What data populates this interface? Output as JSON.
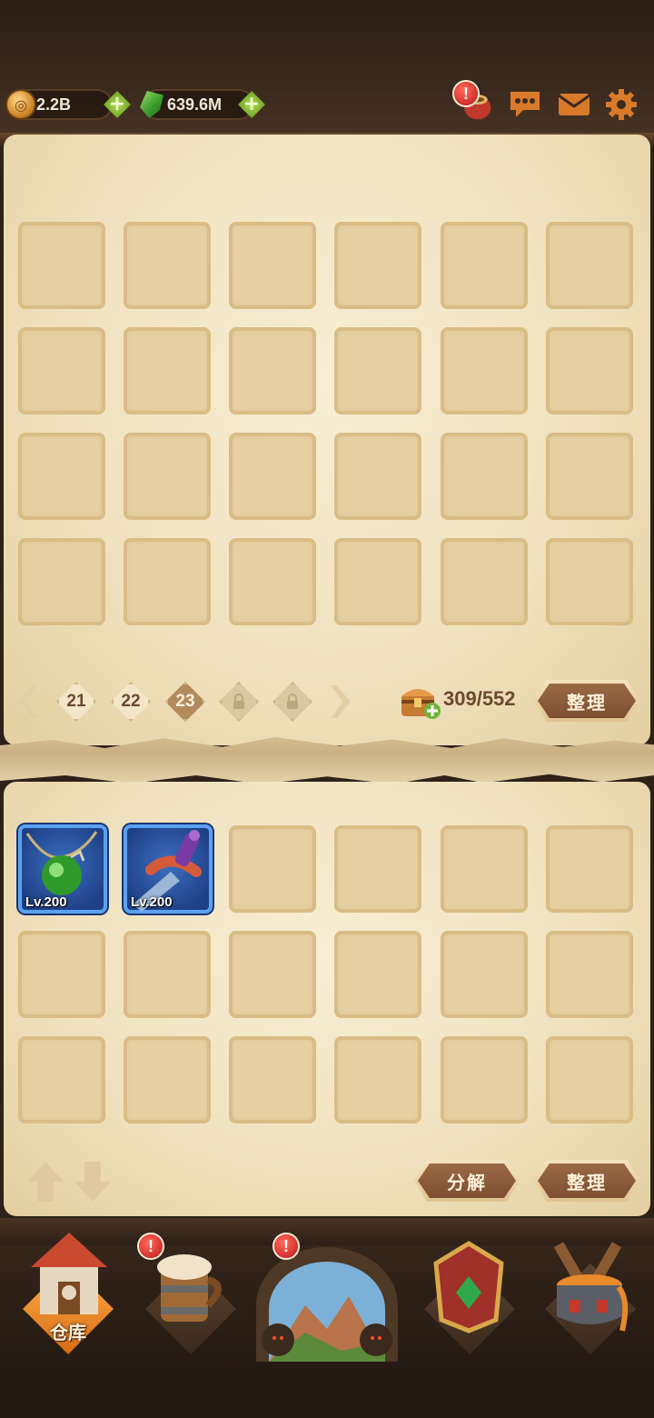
{
  "header": {
    "gold_amount": "2.2B",
    "gem_amount": "639.6M",
    "icons": [
      "coin-icon",
      "gem-icon",
      "sack-icon",
      "chat-icon",
      "mail-icon",
      "settings-icon"
    ],
    "alert_mark": "!"
  },
  "storage": {
    "pages": [
      "21",
      "22",
      "23"
    ],
    "active_page": "23",
    "locked_pages": 2,
    "capacity": "309/552",
    "sort_label": "整理"
  },
  "bag": {
    "items": [
      {
        "name": "green-amulet",
        "level": "Lv.200"
      },
      {
        "name": "dagger",
        "level": "Lv.200"
      }
    ],
    "decompose_label": "分解",
    "sort_label": "整理"
  },
  "nav": {
    "items": [
      {
        "key": "warehouse",
        "label": "仓库",
        "active": true
      },
      {
        "key": "tavern",
        "label": "",
        "alert": true
      },
      {
        "key": "adventure",
        "label": "",
        "alert": true
      },
      {
        "key": "armory",
        "label": ""
      },
      {
        "key": "forge",
        "label": ""
      }
    ]
  },
  "colors": {
    "parchment": "#efe1bd",
    "slot": "#e6d0a2",
    "item_frame_blue": "#5aa2f0",
    "button_brown": "#8b5a38",
    "active_nav_orange": "#e07a1c"
  }
}
